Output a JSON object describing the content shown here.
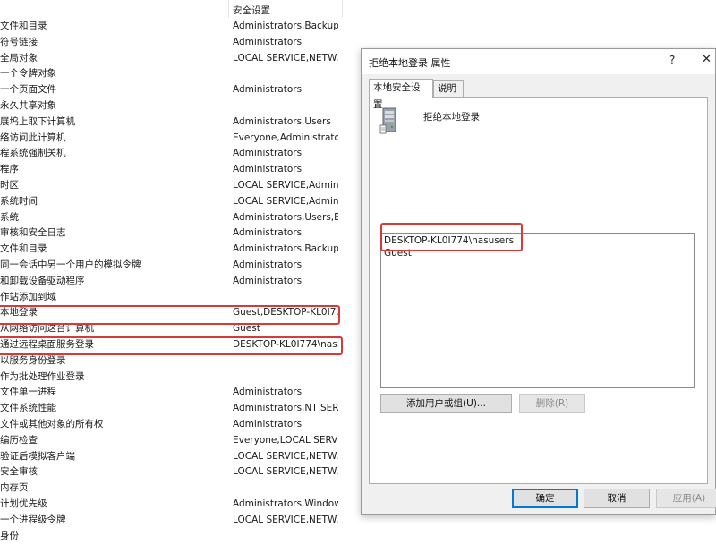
{
  "list": {
    "column_header": "安全设置",
    "rows": [
      {
        "name": "文件和目录",
        "value": "Administrators,Backup ..."
      },
      {
        "name": "符号链接",
        "value": "Administrators"
      },
      {
        "name": "全局对象",
        "value": "LOCAL SERVICE,NETW..."
      },
      {
        "name": "一个令牌对象",
        "value": ""
      },
      {
        "name": "一个页面文件",
        "value": "Administrators"
      },
      {
        "name": "永久共享对象",
        "value": ""
      },
      {
        "name": "展坞上取下计算机",
        "value": "Administrators,Users"
      },
      {
        "name": "络访问此计算机",
        "value": "Everyone,Administrator..."
      },
      {
        "name": "程系统强制关机",
        "value": "Administrators"
      },
      {
        "name": "程序",
        "value": "Administrators"
      },
      {
        "name": "时区",
        "value": "LOCAL SERVICE,Admini..."
      },
      {
        "name": "系统时间",
        "value": "LOCAL SERVICE,Admini..."
      },
      {
        "name": "系统",
        "value": "Administrators,Users,Ba..."
      },
      {
        "name": "审核和安全日志",
        "value": "Administrators"
      },
      {
        "name": "文件和目录",
        "value": "Administrators,Backup ..."
      },
      {
        "name": "同一会话中另一个用户的模拟令牌",
        "value": "Administrators"
      },
      {
        "name": "和卸载设备驱动程序",
        "value": "Administrators"
      },
      {
        "name": "作站添加到域",
        "value": ""
      },
      {
        "name": "本地登录",
        "value": "Guest,DESKTOP-KL0I7..."
      },
      {
        "name": "从网络访问这台计算机",
        "value": "Guest"
      },
      {
        "name": "通过远程桌面服务登录",
        "value": "DESKTOP-KL0I774\\nas..."
      },
      {
        "name": "以服务身份登录",
        "value": ""
      },
      {
        "name": "作为批处理作业登录",
        "value": ""
      },
      {
        "name": "文件单一进程",
        "value": "Administrators"
      },
      {
        "name": "文件系统性能",
        "value": "Administrators,NT SER..."
      },
      {
        "name": "文件或其他对象的所有权",
        "value": "Administrators"
      },
      {
        "name": "编历检查",
        "value": "Everyone,LOCAL SERVI..."
      },
      {
        "name": "验证后模拟客户端",
        "value": "LOCAL SERVICE,NETW..."
      },
      {
        "name": "安全审核",
        "value": "LOCAL SERVICE,NETW..."
      },
      {
        "name": "内存页",
        "value": ""
      },
      {
        "name": "计划优先级",
        "value": "Administrators,Window ..."
      },
      {
        "name": "一个进程级令牌",
        "value": "LOCAL SERVICE,NETW..."
      },
      {
        "name": "身份",
        "value": ""
      }
    ]
  },
  "dialog": {
    "title": "拒绝本地登录 属性",
    "help_glyph": "?",
    "close_glyph": "✕",
    "tabs": [
      {
        "label": "本地安全设置",
        "active": true
      },
      {
        "label": "说明",
        "active": false
      }
    ],
    "policy_name": "拒绝本地登录",
    "users": [
      "DESKTOP-KL0I774\\nasusers",
      "Guest"
    ],
    "add_button": "添加用户或组(U)...",
    "remove_button": "删除(R)",
    "ok_button": "确定",
    "cancel_button": "取消",
    "apply_button": "应用(A)"
  },
  "colors": {
    "highlight": "#d83a3a",
    "dialog_bg": "#f0f0f0",
    "button_bg": "#e1e1e1",
    "focus_border": "#0078d7"
  },
  "icons": {
    "policy": "server-policy-icon",
    "close": "close-icon",
    "help": "help-icon"
  }
}
